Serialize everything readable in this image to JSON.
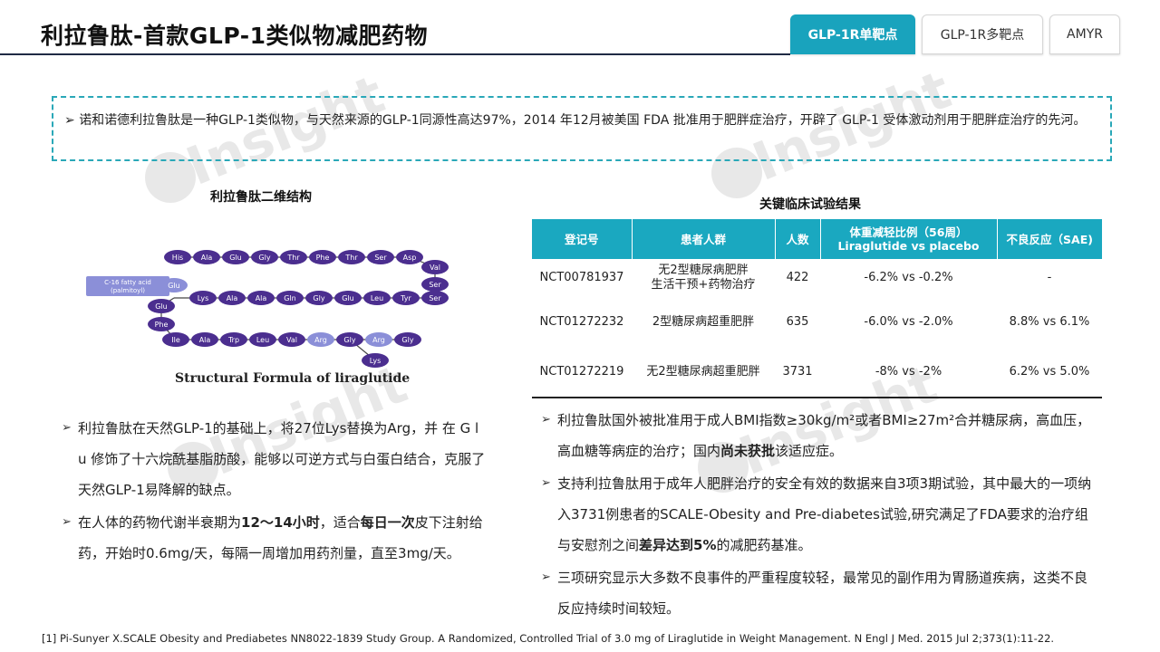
{
  "header": {
    "title": "利拉鲁肽-首款GLP-1类似物减肥药物",
    "tabs": [
      {
        "label": "GLP-1R单靶点",
        "active": true
      },
      {
        "label": "GLP-1R多靶点",
        "active": false
      },
      {
        "label": "AMYR",
        "active": false
      }
    ]
  },
  "intro": {
    "text": "诺和诺德利拉鲁肽是一种GLP-1类似物，与天然来源的GLP-1同源性高达97%，2014 年12月被美国 FDA 批准用于肥胖症治疗，开辟了 GLP-1 受体激动剂用于肥胖症治疗的先河。"
  },
  "structure": {
    "title": "利拉鲁肽二维结构",
    "fatty_acid_label": [
      "C-16 fatty acid",
      "(palmitoyl)"
    ],
    "row1": [
      "His",
      "Ala",
      "Glu",
      "Gly",
      "Thr",
      "Phe",
      "Thr",
      "Ser",
      "Asp"
    ],
    "right_curve": [
      "Val",
      "Ser"
    ],
    "row2": [
      "Glu",
      "Lys",
      "Ala",
      "Ala",
      "Gln",
      "Gly",
      "Glu",
      "Leu",
      "Tyr",
      "Ser"
    ],
    "left_curve": [
      "Glu",
      "Phe"
    ],
    "row3": [
      "Ile",
      "Ala",
      "Trp",
      "Leu",
      "Val",
      "Arg",
      "Gly",
      "Arg",
      "Gly"
    ],
    "tail": "Lys",
    "caption": "Structural Formula of liraglutide"
  },
  "left_bullets": [
    {
      "parts": [
        {
          "t": "利拉鲁肽在天然GLP-1的基础上，将27位Lys替换为Arg，并 在 G l u 修饰了十六烷酰基脂肪酸，能够以可逆方式与白蛋白结合，克服了天然GLP-1易降解的缺点。",
          "b": false
        }
      ]
    },
    {
      "parts": [
        {
          "t": "在人体的药物代谢半衰期为",
          "b": false
        },
        {
          "t": "12～14小时",
          "b": true
        },
        {
          "t": "，适合",
          "b": false
        },
        {
          "t": "每日一次",
          "b": true
        },
        {
          "t": "皮下注射给药，开始时0.6mg/天，每隔一周增加用药剂量，直至3mg/天。",
          "b": false
        }
      ]
    }
  ],
  "clinical": {
    "title": "关键临床试验结果",
    "headers": [
      "登记号",
      "患者人群",
      "人数",
      "体重减轻比例（56周）",
      "Liraglutide vs placebo",
      "不良反应（SAE)"
    ],
    "rows": [
      {
        "id": "NCT00781937",
        "population": [
          "无2型糖尿病肥胖",
          "生活干预+药物治疗"
        ],
        "n": "422",
        "weight": "-6.2% vs -0.2%",
        "sae": "-"
      },
      {
        "id": "NCT01272232",
        "population": [
          "2型糖尿病超重肥胖"
        ],
        "n": "635",
        "weight": "-6.0% vs -2.0%",
        "sae": "8.8% vs 6.1%"
      },
      {
        "id": "NCT01272219",
        "population": [
          "无2型糖尿病超重肥胖"
        ],
        "n": "3731",
        "weight": "-8% vs -2%",
        "sae": "6.2% vs 5.0%"
      }
    ]
  },
  "right_bullets": [
    {
      "parts": [
        {
          "t": "利拉鲁肽国外被批准用于成人BMI指数≥30kg/m²或者BMI≥27m²合并糖尿病，高血压，高血糖等病症的治疗；国内",
          "b": false
        },
        {
          "t": "尚未获批",
          "b": true
        },
        {
          "t": "该适应症。",
          "b": false
        }
      ]
    },
    {
      "parts": [
        {
          "t": "支持利拉鲁肽用于成年人肥胖治疗的安全有效的数据来自3项3期试验，其中最大的一项纳入3731例患者的SCALE-Obesity and Pre-diabetes试验,研究满足了FDA要求的治疗组与安慰剂之间",
          "b": false
        },
        {
          "t": "差异达到5%",
          "b": true
        },
        {
          "t": "的减肥药基准。",
          "b": false
        }
      ]
    },
    {
      "parts": [
        {
          "t": "三项研究显示大多数不良事件的严重程度较轻，最常见的副作用为胃肠道疾病，这类不良反应持续时间较短。",
          "b": false
        }
      ]
    }
  ],
  "footnote": "[1] Pi-Sunyer X.SCALE Obesity and Prediabetes NN8022-1839 Study Group. A Randomized, Controlled Trial of 3.0 mg of Liraglutide in Weight Management. N Engl J Med. 2015 Jul 2;373(1):11-22.",
  "watermark": {
    "text": "Insight"
  },
  "colors": {
    "accent": "#19a3bd",
    "bead": "#4b2e8f",
    "bead_highlight": "#8b8fd8",
    "title_rule": "#1f2a44"
  }
}
